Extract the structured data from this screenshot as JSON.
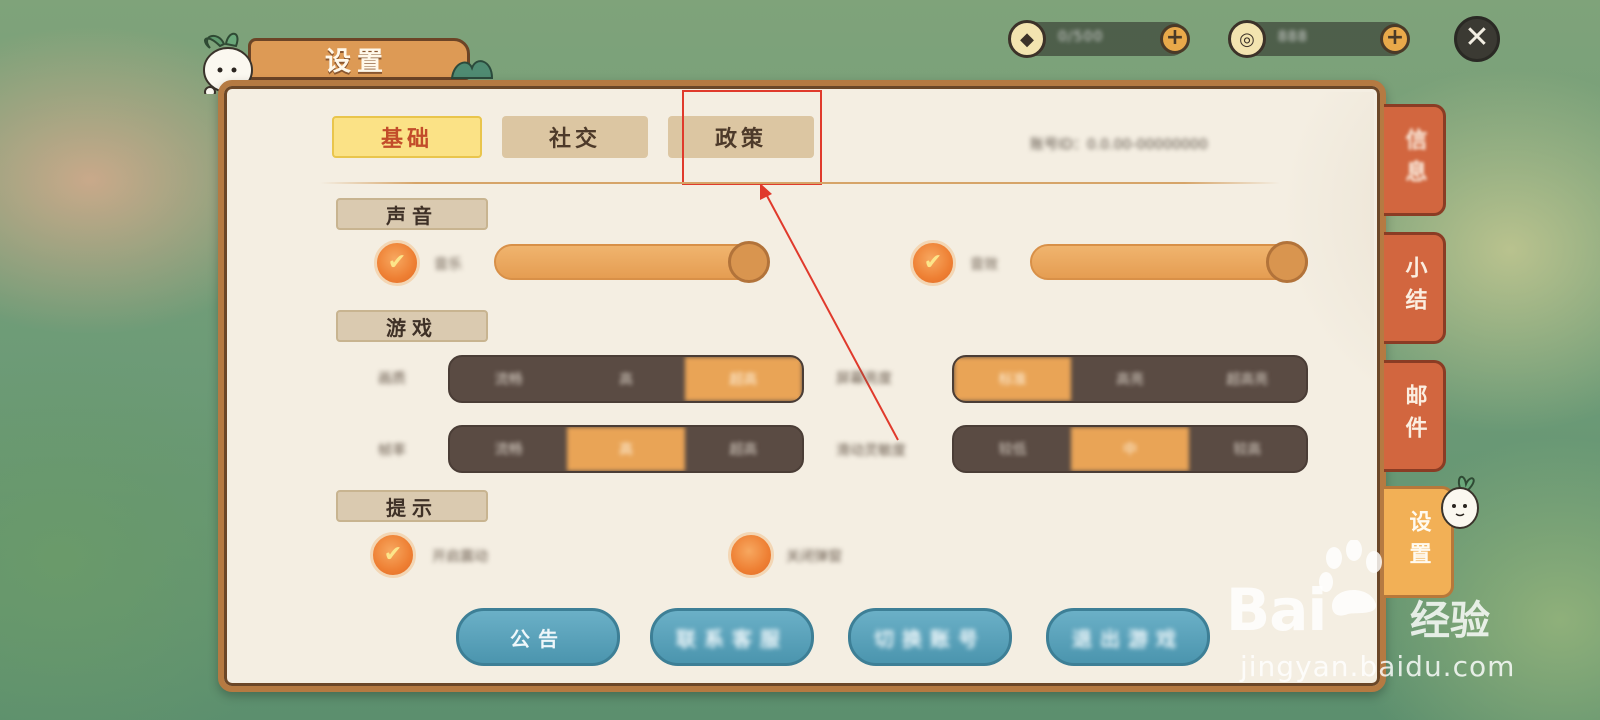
{
  "topbar": {
    "currency1": {
      "icon": "diamond-coin-icon",
      "value": "0/500",
      "plus": "+"
    },
    "currency2": {
      "icon": "ring-coin-icon",
      "value": "888",
      "plus": "+"
    },
    "close": "✕"
  },
  "title": "设置",
  "tabs": [
    {
      "label": "基础",
      "active": true
    },
    {
      "label": "社交",
      "active": false
    },
    {
      "label": "政策",
      "active": false
    }
  ],
  "uid_text": "账号ID：0.0.00-00000000",
  "sections": {
    "sound": {
      "label": "声音",
      "items": [
        {
          "label": "音乐",
          "checked": "✔",
          "level": 1.0
        },
        {
          "label": "音效",
          "checked": "✔",
          "level": 1.0
        }
      ]
    },
    "game": {
      "label": "游戏",
      "rows": [
        {
          "label": "画质",
          "options": [
            "流畅",
            "高",
            "超高"
          ],
          "selected": 2
        },
        {
          "label": "帧率",
          "options": [
            "流畅",
            "高",
            "超高"
          ],
          "selected": 1
        },
        {
          "label": "屏幕亮度",
          "options": [
            "标准",
            "高亮",
            "超高亮"
          ],
          "selected": 0
        },
        {
          "label": "滑动灵敏度",
          "options": [
            "较低",
            "中",
            "较高"
          ],
          "selected": 1
        }
      ]
    },
    "tips": {
      "label": "提示",
      "items": [
        {
          "label": "开启震动",
          "checked": "✔"
        },
        {
          "label": "关闭弹窗",
          "checked": ""
        }
      ]
    }
  },
  "buttons": [
    "公告",
    "联系客服",
    "切换账号",
    "退出游戏"
  ],
  "side_tabs": [
    "信息",
    "小结",
    "邮件",
    "设置"
  ],
  "watermark": {
    "brand": "Bai",
    "brand2": "经验",
    "url": "jingyan.baidu.com"
  },
  "colors": {
    "accent": "#e9a456",
    "highlight": "#e03a2c",
    "panel": "#f4eee2",
    "button_blue": "#4b95ae"
  }
}
